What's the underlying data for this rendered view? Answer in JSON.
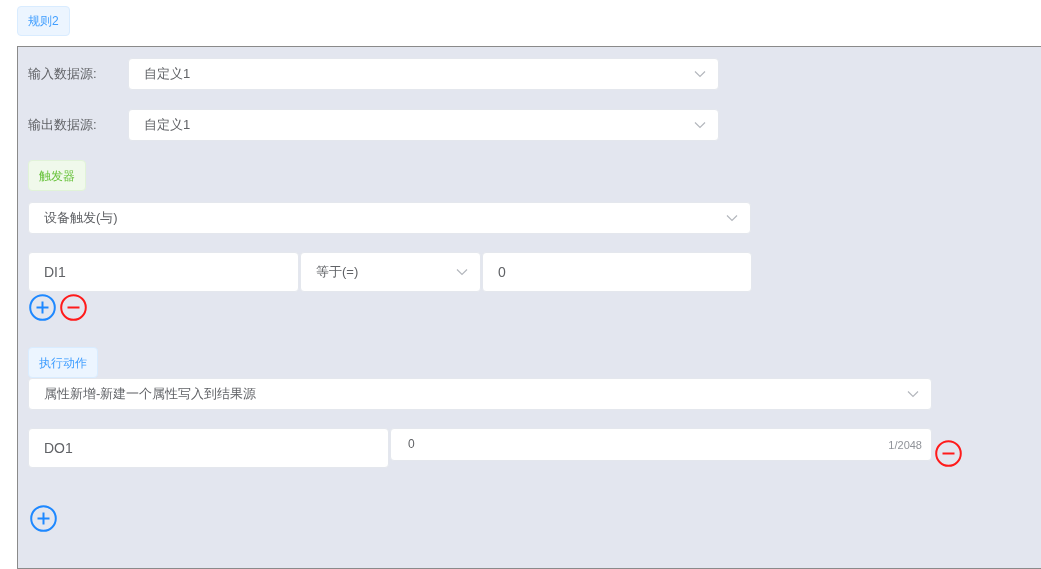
{
  "rule_tag": "规则2",
  "sources": [
    {
      "label": "输入数据源:",
      "value": "自定义1"
    },
    {
      "label": "输出数据源:",
      "value": "自定义1"
    }
  ],
  "trigger": {
    "tag": "触发器",
    "mode": "设备触发(与)",
    "conditions": [
      {
        "variable": "DI1",
        "operator": "等于(=)",
        "value": "0"
      }
    ]
  },
  "action": {
    "tag": "执行动作",
    "type": "属性新增-新建一个属性写入到结果源",
    "items": [
      {
        "name": "DO1",
        "value": "0",
        "counter": "1/2048"
      }
    ]
  }
}
